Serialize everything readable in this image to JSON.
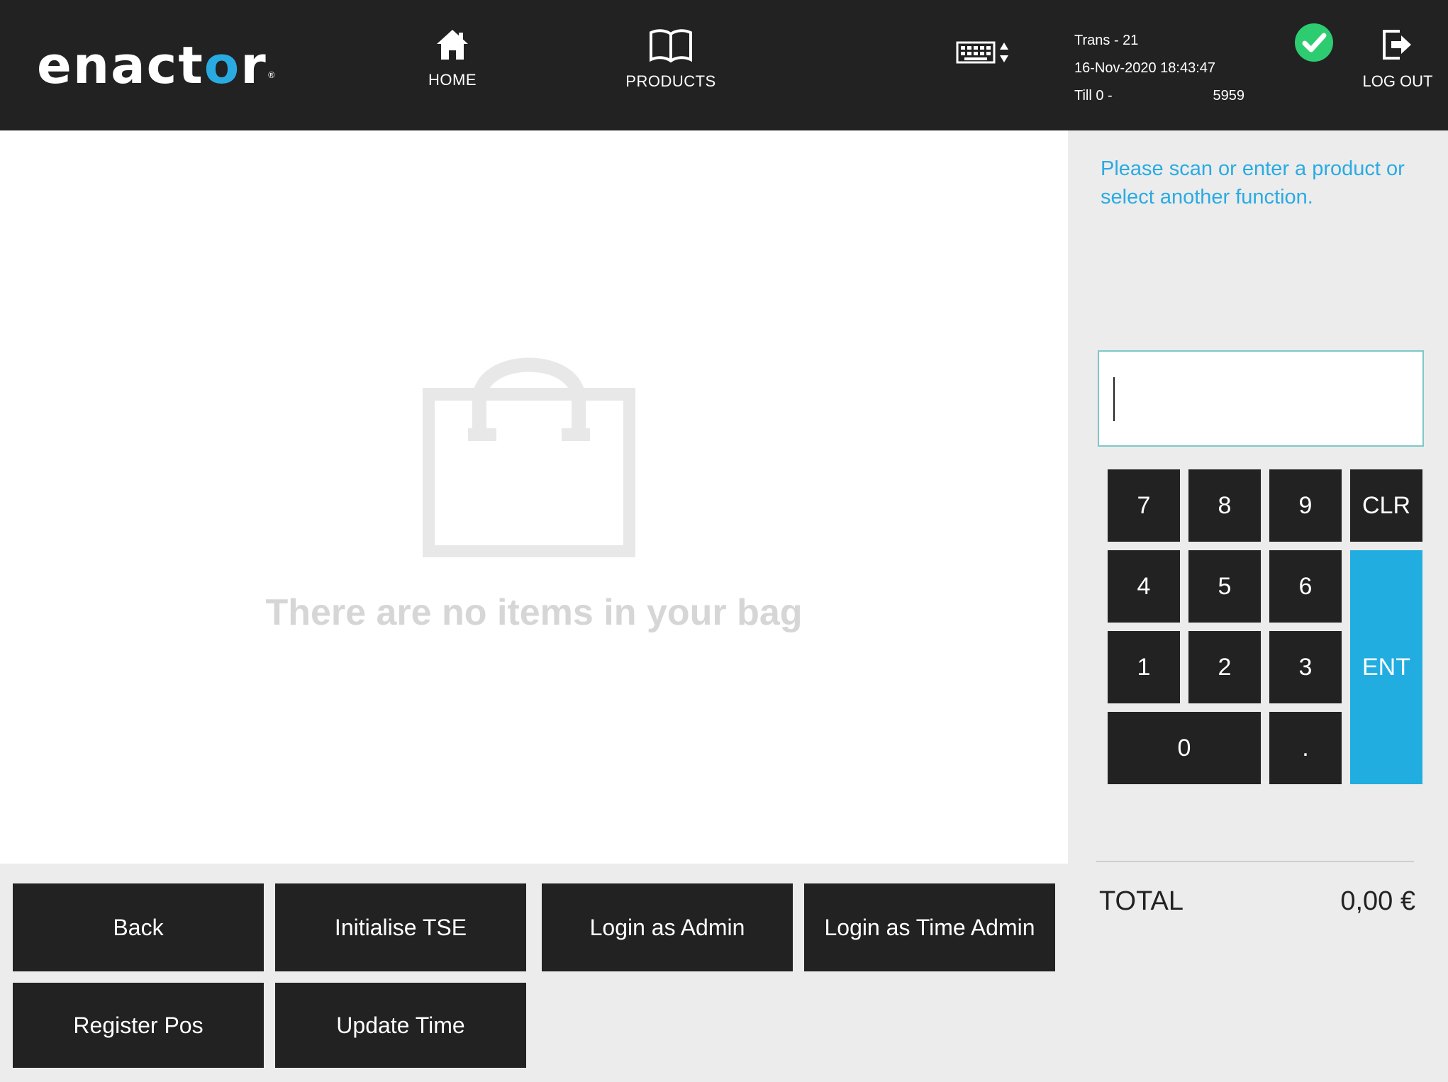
{
  "header": {
    "logo_text_1": "enact",
    "logo_text_2": "o",
    "logo_text_3": "r",
    "nav": {
      "home_label": "HOME",
      "products_label": "PRODUCTS"
    },
    "trans_label": "Trans - 21",
    "datetime": "16-Nov-2020 18:43:47",
    "till_label": "Till 0 -",
    "till_number": "5959",
    "logout_label": "LOG OUT"
  },
  "bag": {
    "empty_message": "There are no items in your bag"
  },
  "functions": {
    "back": "Back",
    "initialise_tse": "Initialise TSE",
    "login_admin": "Login as Admin",
    "login_time_admin": "Login as Time Admin",
    "register_pos": "Register Pos",
    "update_time": "Update Time"
  },
  "panel": {
    "prompt": "Please scan or enter a product or select another function.",
    "entry_value": ""
  },
  "keypad": {
    "k7": "7",
    "k8": "8",
    "k9": "9",
    "clr": "CLR",
    "k4": "4",
    "k5": "5",
    "k6": "6",
    "ent": "ENT",
    "k1": "1",
    "k2": "2",
    "k3": "3",
    "k0": "0",
    "dot": "."
  },
  "totals": {
    "label": "TOTAL",
    "value": "0,00 €"
  },
  "colors": {
    "header_bg": "#222222",
    "accent": "#29abe2",
    "ent_key": "#22ade0",
    "status_ok": "#2ecc71"
  }
}
